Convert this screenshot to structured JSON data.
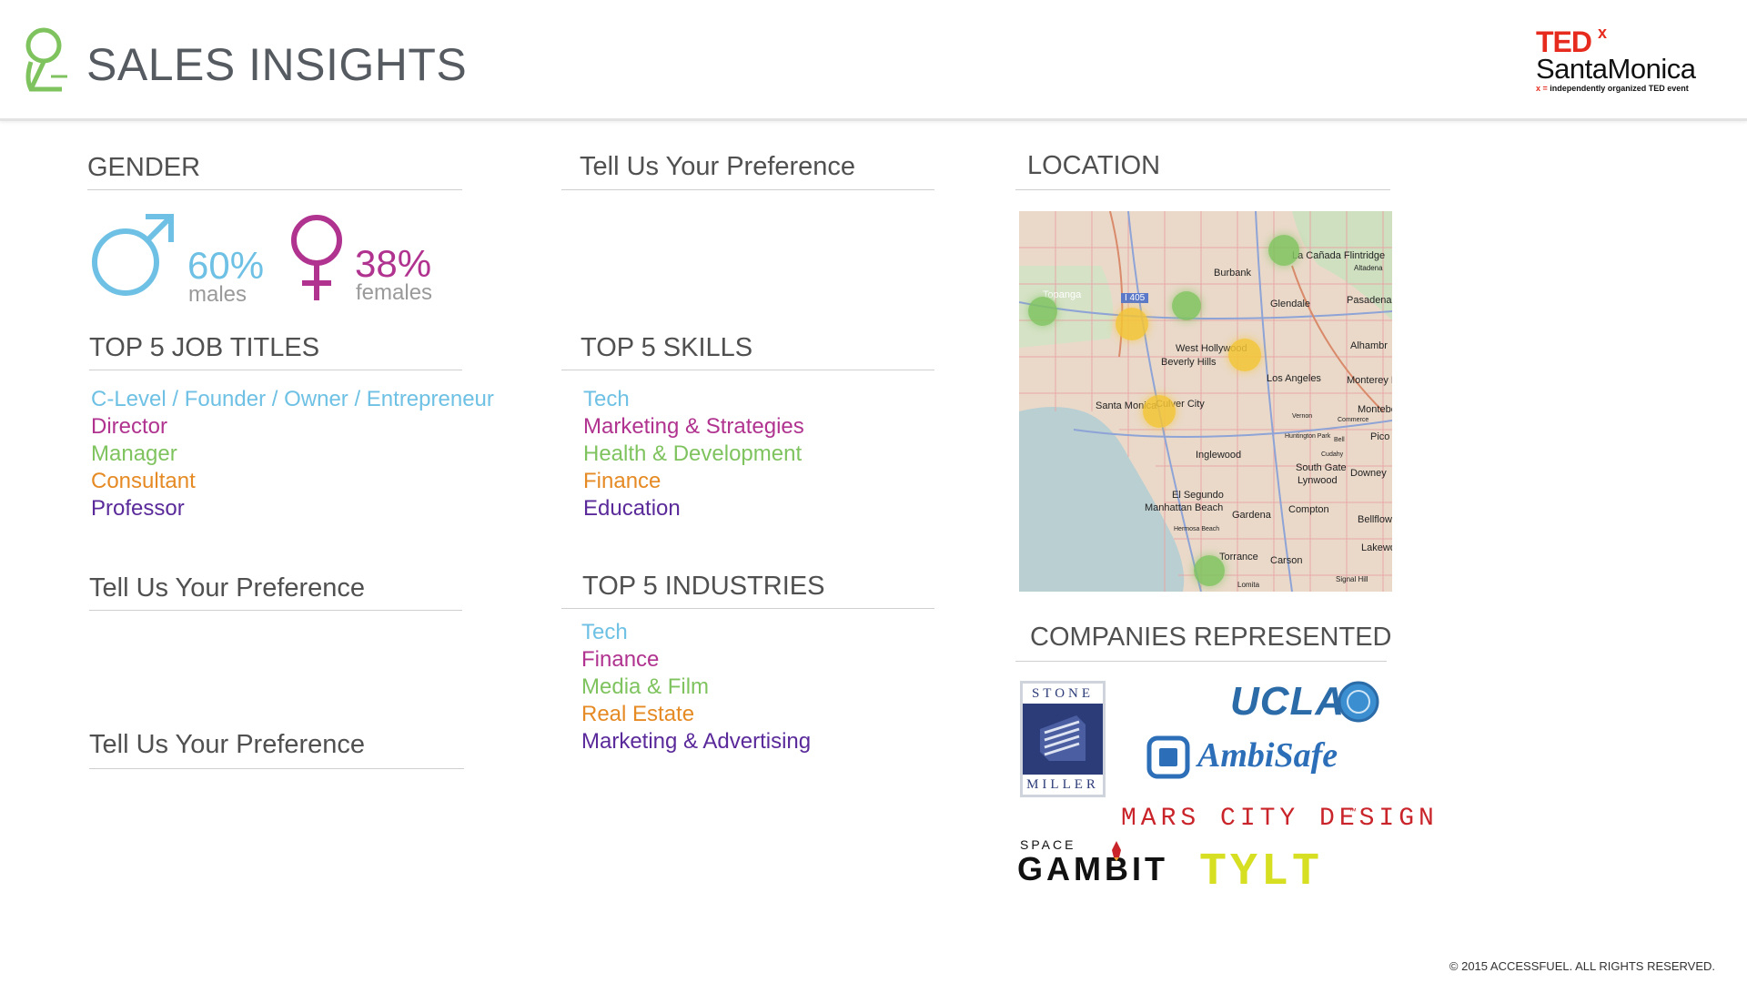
{
  "header": {
    "title": "SALES INSIGHTS",
    "brand_ted": "TED",
    "brand_x": "x",
    "brand_city": "SantaMonica",
    "brand_x_mark": "x =",
    "brand_tagline": "independently organized TED event"
  },
  "gender": {
    "title": "GENDER",
    "male_pct": "60%",
    "male_label": "males",
    "female_pct": "38%",
    "female_label": "females"
  },
  "preference_top": {
    "title": "Tell Us Your Preference"
  },
  "location": {
    "title": "LOCATION"
  },
  "job_titles": {
    "title": "TOP 5 JOB TITLES",
    "items": [
      "C-Level / Founder / Owner / Entrepreneur",
      "Director",
      "Manager",
      "Consultant",
      "Professor"
    ]
  },
  "skills": {
    "title": "TOP 5 SKILLS",
    "items": [
      "Tech",
      "Marketing & Strategies",
      "Health & Development",
      "Finance",
      "Education"
    ]
  },
  "preference_left_1": {
    "title": "Tell Us Your Preference"
  },
  "preference_left_2": {
    "title": "Tell Us Your Preference"
  },
  "industries": {
    "title": "TOP 5 INDUSTRIES",
    "items": [
      "Tech",
      "Finance",
      "Media & Film",
      "Real Estate",
      "Marketing & Advertising"
    ]
  },
  "companies": {
    "title": "COMPANIES REPRESENTED",
    "stone_miller_top": "STONE",
    "stone_miller_bottom": "MILLER",
    "ucla": "UCLA",
    "ambisafe": "AmbiSafe",
    "mars_city": "MARS CITY DESIGN",
    "mars_tm": "™",
    "space_gambit_top": "SPACE",
    "space_gambit": "GAMBIT",
    "tylt": "TYLT"
  },
  "map_labels": [
    "Burbank",
    "La Cañada Flintridge",
    "Altadena",
    "Glendale",
    "Pasadena",
    "I 405",
    "West Hollywood",
    "Beverly Hills",
    "Los Angeles",
    "Monterey P",
    "Alhambr",
    "Santa Monica",
    "Culver City",
    "Inglewood",
    "South Gate",
    "Lynwood",
    "Downey",
    "El Segundo",
    "Manhattan Beach",
    "Gardena",
    "Compton",
    "Torrance",
    "Carson",
    "Hermosa Beach",
    "Bellflow",
    "Lakewo",
    "Topanga",
    "Pico",
    "Montebe",
    "Huntington Park",
    "Vernon",
    "Commerce",
    "Cudahy",
    "Bell",
    "Lomita",
    "Signal Hill"
  ],
  "footer": "© 2015 ACCESSFUEL.  ALL RIGHTS RESERVED.",
  "colors": {
    "male": "#6ec1e4",
    "female": "#b0338f",
    "accent_green": "#7fc35f",
    "orange": "#e58a24",
    "purple": "#5a2a9a",
    "ted_red": "#e62b1e"
  },
  "icons": [
    "brand-logo-icon",
    "male-symbol-icon",
    "female-symbol-icon"
  ]
}
